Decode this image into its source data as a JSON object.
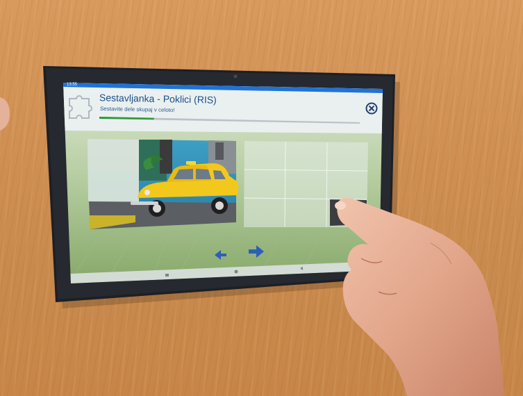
{
  "app": {
    "title": "Sestavljanka - Poklici (RIS)",
    "subtitle": "Sestavite dele skupaj v celoto!",
    "status_time": "13:55",
    "progress": 0.21
  },
  "icons": {
    "app_icon": "puzzle-icon",
    "close": "close-icon",
    "prev": "arrow-left-icon",
    "next": "arrow-right-icon"
  },
  "colors": {
    "status_bar": "#1e73d8",
    "progress_fill": "#2e9a3a",
    "arrow": "#2d5fb8",
    "taxi": "#f2c81c"
  }
}
